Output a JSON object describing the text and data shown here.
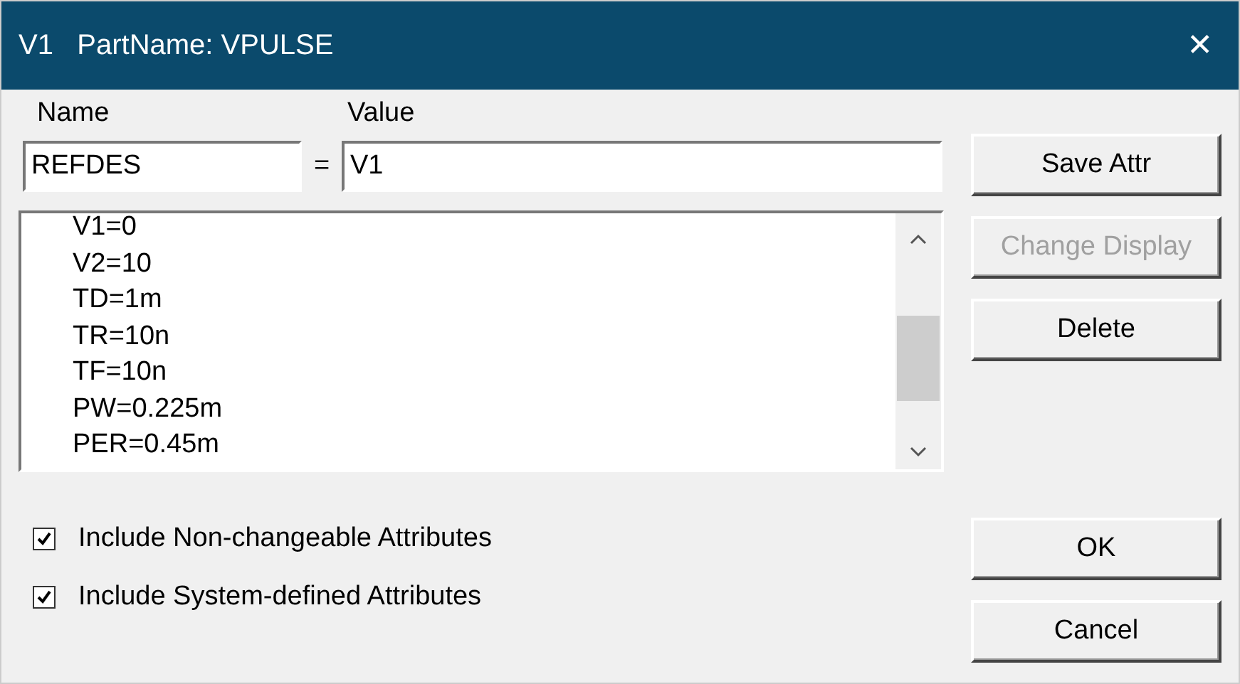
{
  "window": {
    "title": "V1   PartName: VPULSE",
    "close": "✕"
  },
  "labels": {
    "name": "Name",
    "value": "Value"
  },
  "fields": {
    "name": "REFDES",
    "equals": "=",
    "value": "V1"
  },
  "attributes": [
    "V1=0",
    "V2=10",
    "TD=1m",
    "TR=10n",
    "TF=10n",
    "PW=0.225m",
    "PER=0.45m"
  ],
  "options": [
    {
      "label": "Include Non-changeable Attributes",
      "checked": true
    },
    {
      "label": "Include System-defined Attributes",
      "checked": true
    }
  ],
  "edit_buttons": [
    {
      "label": "Save Attr",
      "disabled": false
    },
    {
      "label": "Change Display",
      "disabled": true
    },
    {
      "label": "Delete",
      "disabled": false
    }
  ],
  "dialog_buttons": [
    {
      "label": "OK",
      "disabled": false
    },
    {
      "label": "Cancel",
      "disabled": false
    }
  ]
}
